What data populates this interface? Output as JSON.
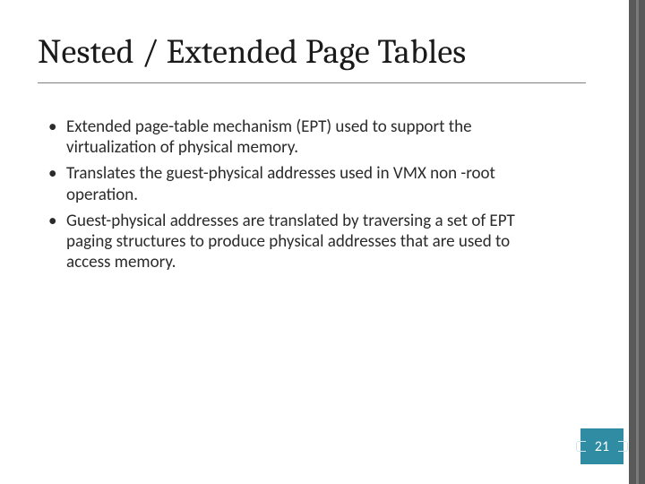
{
  "slide": {
    "title": "Nested / Extended Page Tables",
    "bullets": [
      "Extended page-table mechanism (EPT) used to support the virtualization of physical memory.",
      "Translates the guest-physical addresses used in VMX non -root operation.",
      "Guest-physical addresses are translated by traversing a set of EPT paging structures to produce physical addresses that are used to access memory."
    ],
    "page_number": "21"
  }
}
